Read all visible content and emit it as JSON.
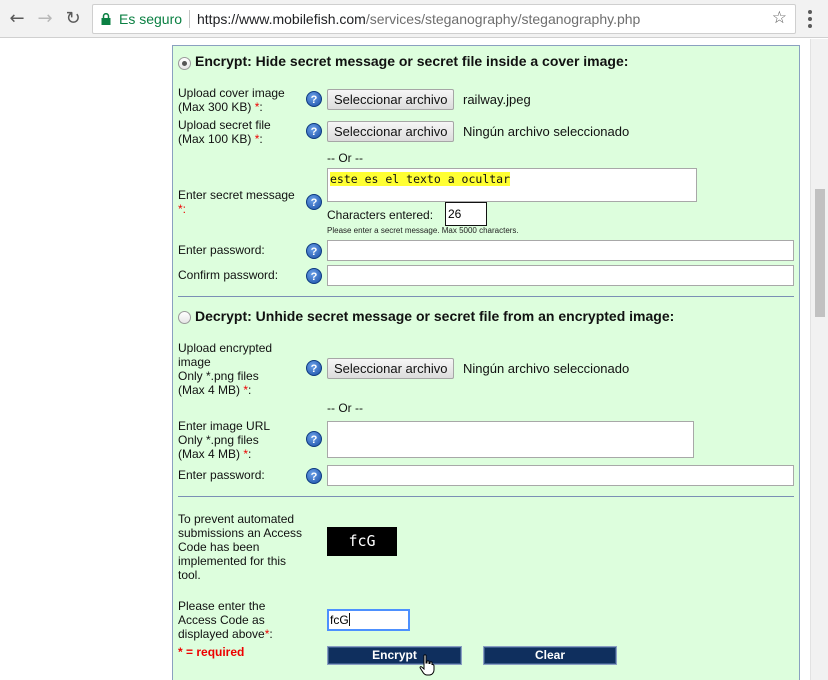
{
  "browser": {
    "secure_label": "Es seguro",
    "url_host": "https://www.mobilefish.com",
    "url_path": "/services/steganography/steganography.php"
  },
  "encrypt": {
    "heading": "Encrypt: Hide secret message or secret file inside a cover image:",
    "cover_label_line1": "Upload cover image",
    "cover_label_line2": "(Max 300 KB)",
    "cover_button": "Seleccionar archivo",
    "cover_file": "railway.jpeg",
    "secretfile_label_line1": "Upload secret file",
    "secretfile_label_line2": "(Max 100 KB)",
    "secretfile_button": "Seleccionar archivo",
    "secretfile_file": "Ningún archivo seleccionado",
    "or_label": "-- Or --",
    "message_label": "Enter secret message",
    "message_value": "este es el texto a ocultar",
    "chars_label": "Characters entered:",
    "chars_value": "26",
    "hint": "Please enter a secret message. Max 5000 characters.",
    "password_label": "Enter password:",
    "confirm_label": "Confirm password:"
  },
  "decrypt": {
    "heading": "Decrypt: Unhide secret message or secret file from an encrypted image:",
    "upload_label_line1": "Upload encrypted",
    "upload_label_line2": "image",
    "upload_label_line3": "Only *.png files",
    "upload_label_line4": "(Max 4 MB)",
    "upload_button": "Seleccionar archivo",
    "upload_file": "Ningún archivo seleccionado",
    "or_label": "-- Or --",
    "url_label_line1": "Enter image URL",
    "url_label_line2": "Only *.png files",
    "url_label_line3": "(Max 4 MB)",
    "password_label": "Enter password:"
  },
  "captcha": {
    "info_line1": "To prevent automated",
    "info_line2": "submissions an Access",
    "info_line3": "Code has been",
    "info_line4": "implemented for this",
    "info_line5": "tool.",
    "code_image_text": "fcG",
    "prompt_line1": "Please enter the",
    "prompt_line2": "Access Code as",
    "prompt_line3": "displayed above",
    "input_value": "fcG",
    "required_note": "* = required"
  },
  "actions": {
    "encrypt_label": "Encrypt",
    "clear_label": "Clear"
  },
  "colors": {
    "panel_bg": "#ddfedd",
    "button_bg": "#0f2f5e",
    "secure_green": "#0b8043",
    "required_red": "#e00000"
  }
}
